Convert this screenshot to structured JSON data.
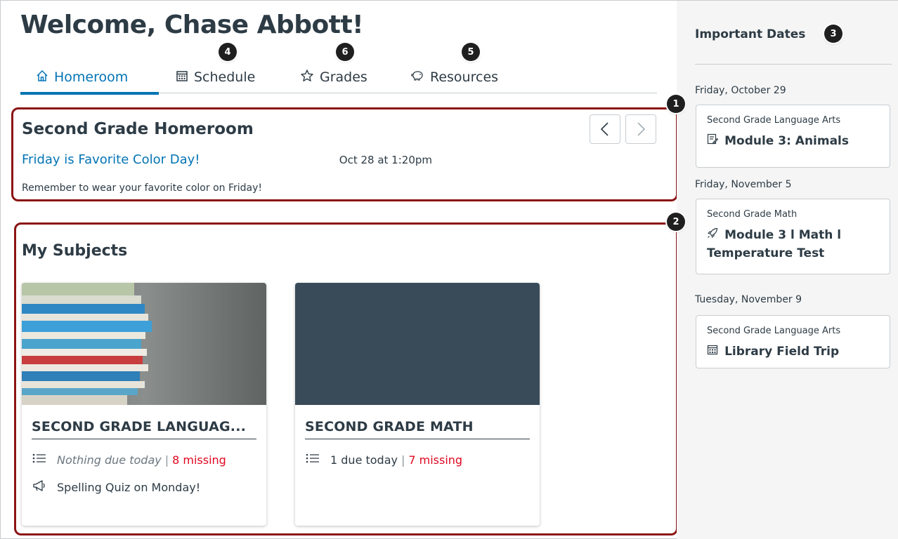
{
  "welcome": "Welcome, Chase Abbott!",
  "tabs": [
    {
      "label": "Homeroom",
      "icon": "home-icon"
    },
    {
      "label": "Schedule",
      "icon": "calendar-icon"
    },
    {
      "label": "Grades",
      "icon": "star-icon"
    },
    {
      "label": "Resources",
      "icon": "piggy-bank-icon"
    }
  ],
  "callouts": {
    "one": "1",
    "two": "2",
    "three": "3",
    "four": "4",
    "five": "5",
    "six": "6"
  },
  "announcement": {
    "course": "Second Grade Homeroom",
    "title": "Friday is Favorite Color Day!",
    "date": "Oct 28 at 1:20pm",
    "body": "Remember to wear your favorite color on Friday!"
  },
  "subjects": {
    "heading": "My Subjects",
    "cards": [
      {
        "title": "SECOND GRADE LANGUAG...",
        "due": "Nothing due today",
        "missing": "8 missing",
        "announcement": "Spelling Quiz on Monday!",
        "image": "stack-of-books"
      },
      {
        "title": "SECOND GRADE MATH",
        "due": "1 due today",
        "missing": "7 missing",
        "color": "#394b58"
      }
    ]
  },
  "sidebar": {
    "title": "Important Dates",
    "groups": [
      {
        "date": "Friday, October 29",
        "course": "Second Grade Language Arts",
        "item": "Module 3: Animals",
        "icon": "assignment-icon"
      },
      {
        "date": "Friday, November 5",
        "course": "Second Grade Math",
        "item": "Module 3 l Math l Temperature Test",
        "icon": "rocket-icon"
      },
      {
        "date": "Tuesday, November 9",
        "course": "Second Grade Language Arts",
        "item": "Library Field Trip",
        "icon": "calendar-icon"
      }
    ]
  },
  "colors": {
    "accent": "#0374b5",
    "missing": "#e0061f",
    "highlight": "#8b1414",
    "text": "#2d3b45"
  }
}
